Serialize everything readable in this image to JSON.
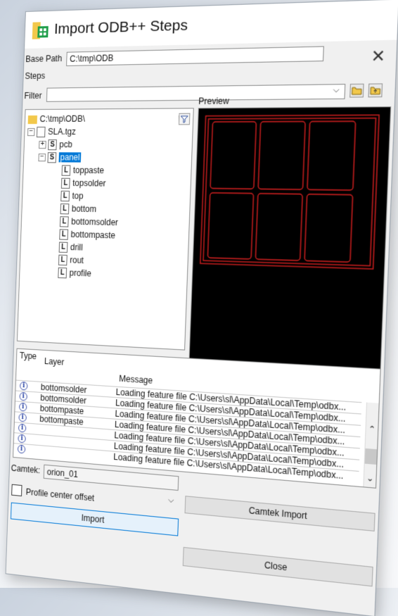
{
  "window": {
    "title": "Import ODB++ Steps"
  },
  "base_path": {
    "label": "Base Path",
    "value": "C:\\tmp\\ODB"
  },
  "steps": {
    "label": "Steps"
  },
  "filter": {
    "label": "Filter",
    "value": ""
  },
  "preview": {
    "label": "Preview"
  },
  "tree": {
    "root": "C:\\tmp\\ODB\\",
    "archive": "SLA.tgz",
    "pcb": "pcb",
    "panel": "panel",
    "layers": [
      "toppaste",
      "topsolder",
      "top",
      "bottom",
      "bottomsolder",
      "bottompaste",
      "drill",
      "rout",
      "profile"
    ]
  },
  "log": {
    "headers": {
      "type": "Type",
      "layer": "Layer",
      "message": "Message"
    },
    "rows": [
      {
        "layer": "bottomsolder",
        "message": "Loading feature file C:\\Users\\sl\\AppData\\Local\\Temp\\odbx..."
      },
      {
        "layer": "bottomsolder",
        "message": "Loading feature file C:\\Users\\sl\\AppData\\Local\\Temp\\odbx..."
      },
      {
        "layer": "bottompaste",
        "message": "Loading feature file C:\\Users\\sl\\AppData\\Local\\Temp\\odbx..."
      },
      {
        "layer": "bottompaste",
        "message": "Loading feature file C:\\Users\\sl\\AppData\\Local\\Temp\\odbx..."
      },
      {
        "layer": "",
        "message": "Loading feature file C:\\Users\\sl\\AppData\\Local\\Temp\\odbx..."
      },
      {
        "layer": "",
        "message": "Loading feature file C:\\Users\\sl\\AppData\\Local\\Temp\\odbx..."
      },
      {
        "layer": "",
        "message": "Loading feature file C:\\Users\\sl\\AppData\\Local\\Temp\\odbx..."
      }
    ]
  },
  "camtek": {
    "label": "Camtek:",
    "value": "orion_01",
    "import_button": "Camtek Import"
  },
  "profile_center_offset": {
    "label": "Profile center offset",
    "checked": false
  },
  "buttons": {
    "import": "Import",
    "close": "Close"
  },
  "icons": {
    "close": "close-icon",
    "filter": "funnel-icon",
    "folder_open": "folder-open-icon",
    "folder_up": "folder-up-icon",
    "info": "info-icon"
  },
  "colors": {
    "preview_bg": "#000000",
    "outline": "#cc1f1f",
    "selection": "#0078d7"
  }
}
